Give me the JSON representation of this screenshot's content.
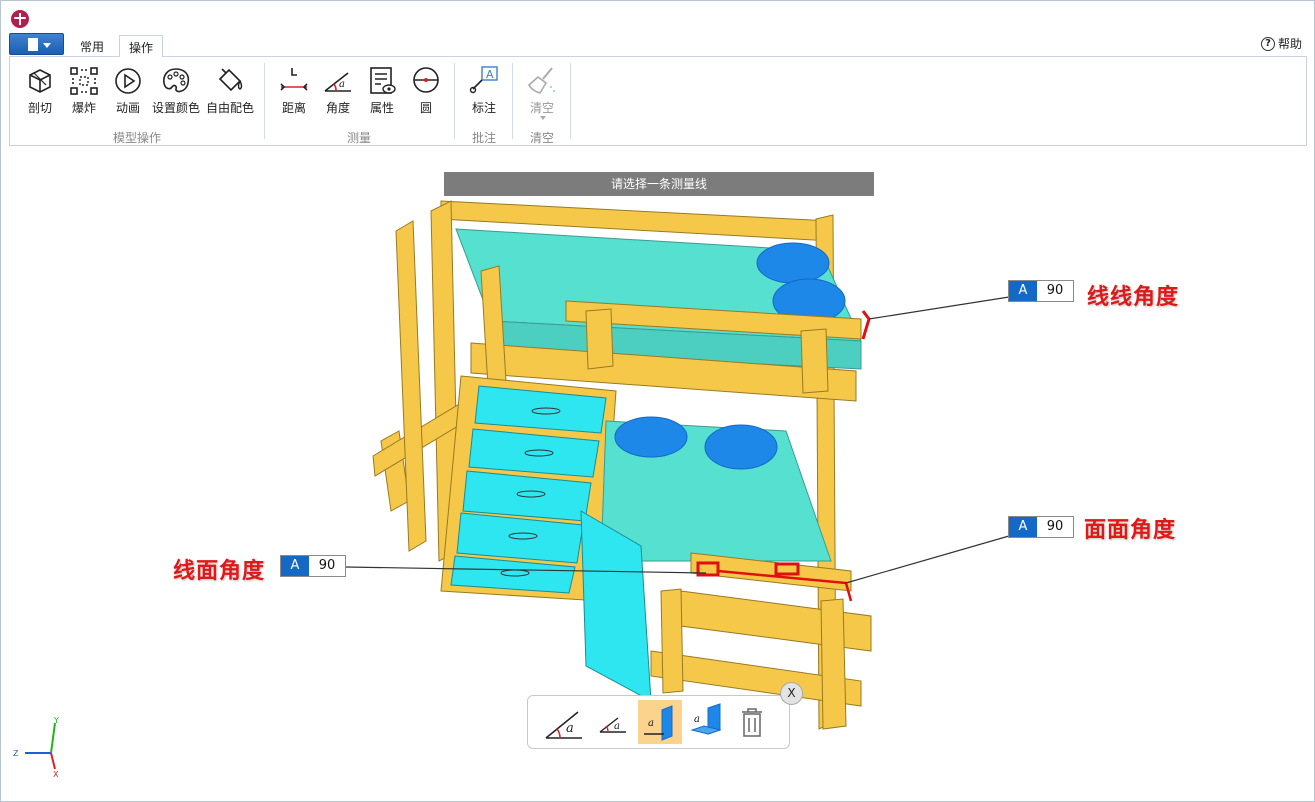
{
  "tabs": [
    {
      "label": "常用"
    },
    {
      "label": "操作"
    }
  ],
  "help_label": "帮助",
  "ribbon": {
    "model_ops": {
      "group_label": "模型操作",
      "items": [
        {
          "label": "剖切",
          "icon": "cube-section-icon"
        },
        {
          "label": "爆炸",
          "icon": "explode-icon"
        },
        {
          "label": "动画",
          "icon": "play-icon"
        },
        {
          "label": "设置颜色",
          "icon": "palette-icon"
        },
        {
          "label": "自由配色",
          "icon": "paint-bucket-icon"
        }
      ]
    },
    "measure": {
      "group_label": "测量",
      "items": [
        {
          "label": "距离",
          "icon": "distance-icon"
        },
        {
          "label": "角度",
          "icon": "angle-icon"
        },
        {
          "label": "属性",
          "icon": "properties-icon"
        },
        {
          "label": "圆",
          "icon": "circle-icon"
        }
      ]
    },
    "annotation": {
      "group_label": "批注",
      "items": [
        {
          "label": "标注",
          "icon": "annotate-icon"
        }
      ]
    },
    "clear": {
      "group_label": "清空",
      "items": [
        {
          "label": "清空",
          "icon": "broom-icon"
        }
      ]
    }
  },
  "prompt": "请选择一条测量线",
  "measurements": [
    {
      "tag": "A",
      "value": "90",
      "label": "线线角度"
    },
    {
      "tag": "A",
      "value": "90",
      "label": "面面角度"
    },
    {
      "tag": "A",
      "value": "90",
      "label": "线面角度"
    }
  ],
  "close_label": "X",
  "axis": {
    "y": "Y",
    "z": "Z",
    "x": "X"
  },
  "colors": {
    "frame": "#f5c84a",
    "mattress": "#55e0d0",
    "pillow": "#1e88e8",
    "drawer": "#2ee6f0",
    "accent_blue": "#1469c7",
    "note_red": "#e01818",
    "selection_red": "#e01010"
  }
}
